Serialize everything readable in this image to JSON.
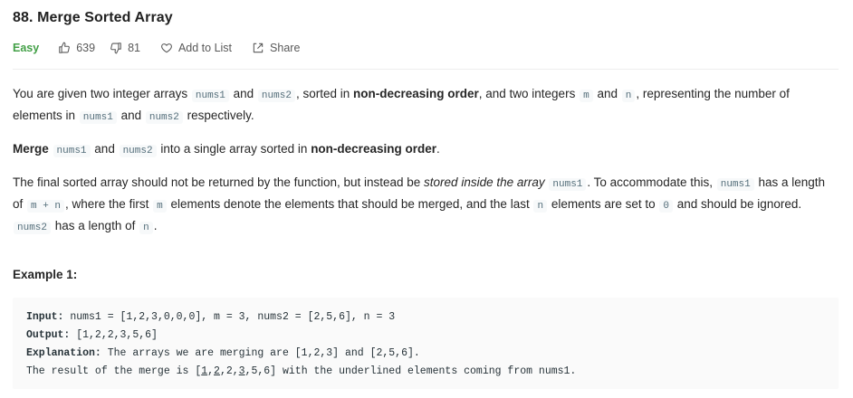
{
  "problem": {
    "title": "88. Merge Sorted Array",
    "difficulty": "Easy",
    "difficulty_color": "#43a047",
    "likes": "639",
    "dislikes": "81",
    "add_to_list_label": "Add to List",
    "share_label": "Share"
  },
  "description": {
    "p1": {
      "t1": "You are given two integer arrays ",
      "c1": "nums1",
      "t2": " and ",
      "c2": "nums2",
      "t3": ", sorted in ",
      "b1": "non-decreasing order",
      "t4": ", and two integers ",
      "c3": "m",
      "t5": " and ",
      "c4": "n",
      "t6": ", representing the number of elements in ",
      "c5": "nums1",
      "t7": " and ",
      "c6": "nums2",
      "t8": " respectively."
    },
    "p2": {
      "b1": "Merge",
      "t1": " ",
      "c1": "nums1",
      "t2": " and ",
      "c2": "nums2",
      "t3": " into a single array sorted in ",
      "b2": "non-decreasing order",
      "t4": "."
    },
    "p3": {
      "t1": "The final sorted array should not be returned by the function, but instead be ",
      "i1": "stored inside the array",
      "t2": " ",
      "c1": "nums1",
      "t3": ". To accommodate this, ",
      "c2": "nums1",
      "t4": " has a length of ",
      "c3": "m + n",
      "t5": ", where the first ",
      "c4": "m",
      "t6": " elements denote the elements that should be merged, and the last ",
      "c5": "n",
      "t7": " elements are set to ",
      "c6": "0",
      "t8": " and should be ignored. ",
      "c7": "nums2",
      "t9": " has a length of ",
      "c8": "n",
      "t10": "."
    }
  },
  "example1": {
    "title": "Example 1:",
    "input_label": "Input:",
    "input_value": " nums1 = [1,2,3,0,0,0], m = 3, nums2 = [2,5,6], n = 3",
    "output_label": "Output:",
    "output_value": " [1,2,2,3,5,6]",
    "explanation_label": "Explanation:",
    "explanation_value": " The arrays we are merging are [1,2,3] and [2,5,6].",
    "result_prefix": "The result of the merge is [",
    "r1": "1",
    "s1": ",",
    "r2": "2",
    "s2": ",2,",
    "r3": "3",
    "result_suffix": ",5,6] with the underlined elements coming from nums1."
  }
}
